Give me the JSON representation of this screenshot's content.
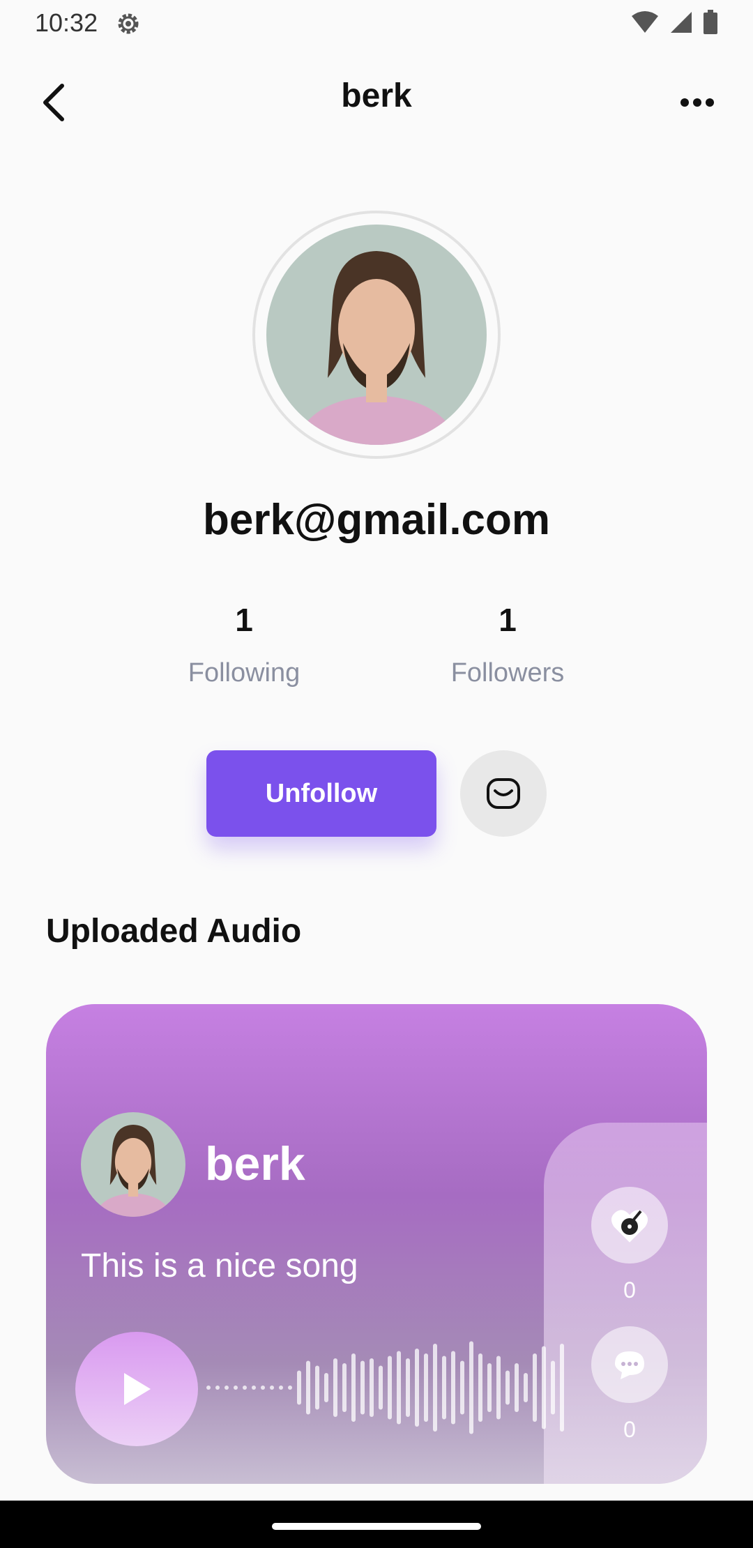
{
  "status_bar": {
    "time": "10:32"
  },
  "header": {
    "title": "berk"
  },
  "profile": {
    "email": "berk@gmail.com"
  },
  "stats": {
    "following": {
      "count": "1",
      "label": "Following"
    },
    "followers": {
      "count": "1",
      "label": "Followers"
    }
  },
  "actions": {
    "unfollow_label": "Unfollow"
  },
  "section": {
    "title": "Uploaded Audio"
  },
  "audio_card": {
    "username": "berk",
    "description": "This is a nice song",
    "likes": "0",
    "comments": "0",
    "waveform_levels": [
      0.02,
      0.02,
      0.02,
      0.02,
      0.02,
      0.02,
      0.02,
      0.02,
      0.02,
      0.02,
      0.35,
      0.55,
      0.45,
      0.3,
      0.6,
      0.5,
      0.7,
      0.55,
      0.6,
      0.45,
      0.65,
      0.75,
      0.6,
      0.8,
      0.7,
      0.9,
      0.65,
      0.75,
      0.55,
      0.95,
      0.7,
      0.5,
      0.65,
      0.35,
      0.5,
      0.3,
      0.7,
      0.85,
      0.55,
      0.9
    ],
    "colors": {
      "accent": "#7b51ec",
      "card_top": "#c680e2",
      "card_bottom": "#c8bed3"
    }
  }
}
